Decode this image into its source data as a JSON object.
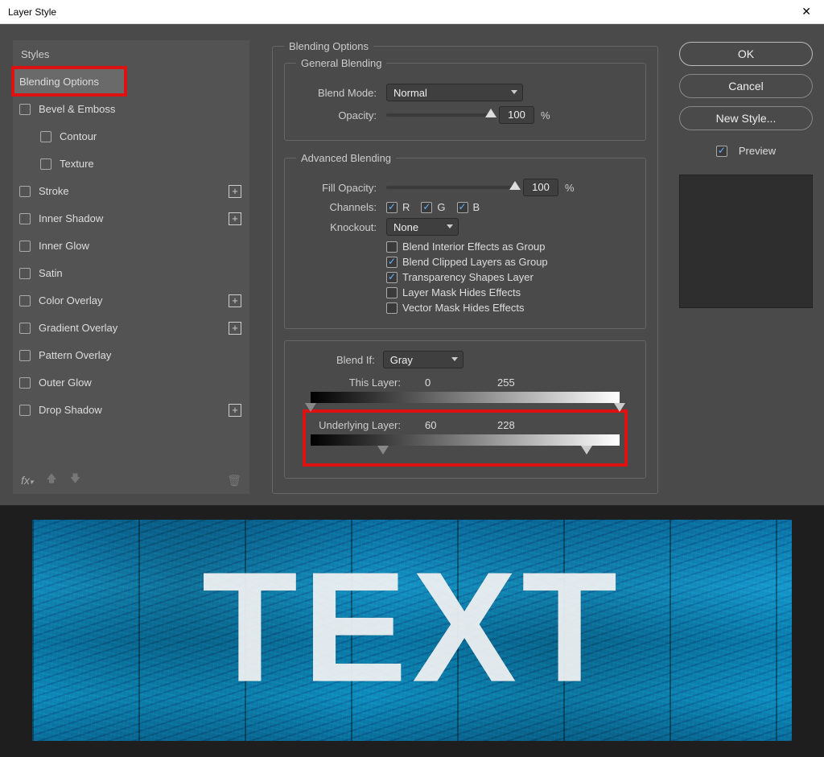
{
  "window": {
    "title": "Layer Style"
  },
  "left": {
    "header": "Styles",
    "items": [
      {
        "label": "Blending Options",
        "selected": true,
        "highlighted": true,
        "checkbox": false
      },
      {
        "label": "Bevel & Emboss",
        "checkbox": true
      },
      {
        "label": "Contour",
        "checkbox": true,
        "indent": true
      },
      {
        "label": "Texture",
        "checkbox": true,
        "indent": true
      },
      {
        "label": "Stroke",
        "checkbox": true,
        "add": true
      },
      {
        "label": "Inner Shadow",
        "checkbox": true,
        "add": true
      },
      {
        "label": "Inner Glow",
        "checkbox": true
      },
      {
        "label": "Satin",
        "checkbox": true
      },
      {
        "label": "Color Overlay",
        "checkbox": true,
        "add": true
      },
      {
        "label": "Gradient Overlay",
        "checkbox": true,
        "add": true
      },
      {
        "label": "Pattern Overlay",
        "checkbox": true
      },
      {
        "label": "Outer Glow",
        "checkbox": true
      },
      {
        "label": "Drop Shadow",
        "checkbox": true,
        "add": true
      }
    ]
  },
  "mid": {
    "title": "Blending Options",
    "general": {
      "legend": "General Blending",
      "blend_mode_label": "Blend Mode:",
      "blend_mode_value": "Normal",
      "opacity_label": "Opacity:",
      "opacity_value": "100",
      "pct": "%"
    },
    "advanced": {
      "legend": "Advanced Blending",
      "fill_label": "Fill Opacity:",
      "fill_value": "100",
      "pct": "%",
      "channels_label": "Channels:",
      "ch_r": "R",
      "ch_g": "G",
      "ch_b": "B",
      "knockout_label": "Knockout:",
      "knockout_value": "None",
      "opts": [
        {
          "label": "Blend Interior Effects as Group",
          "checked": false
        },
        {
          "label": "Blend Clipped Layers as Group",
          "checked": true
        },
        {
          "label": "Transparency Shapes Layer",
          "checked": true
        },
        {
          "label": "Layer Mask Hides Effects",
          "checked": false
        },
        {
          "label": "Vector Mask Hides Effects",
          "checked": false
        }
      ]
    },
    "blendif": {
      "label": "Blend If:",
      "value": "Gray",
      "this_label": "This Layer:",
      "this_lo": "0",
      "this_hi": "255",
      "under_label": "Underlying Layer:",
      "under_lo": "60",
      "under_hi": "228"
    }
  },
  "right": {
    "ok": "OK",
    "cancel": "Cancel",
    "new_style": "New Style...",
    "preview": "Preview"
  },
  "canvas": {
    "text": "TEXT"
  }
}
